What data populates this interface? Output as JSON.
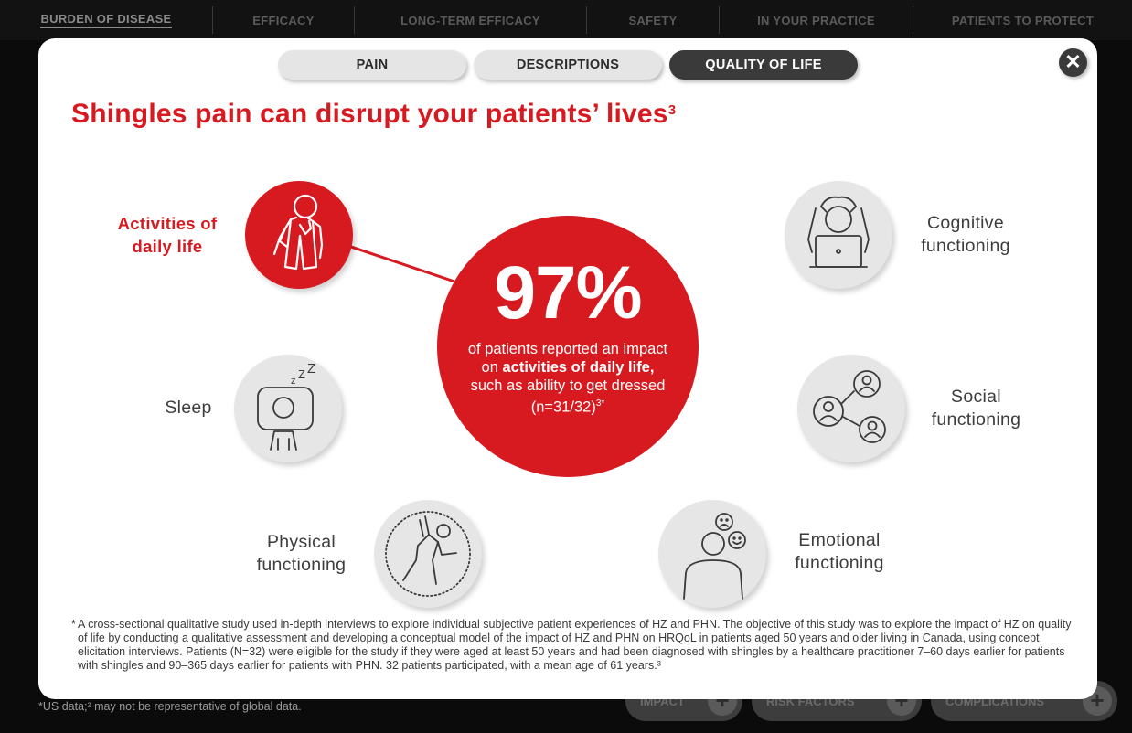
{
  "nav": {
    "items": [
      "BURDEN OF DISEASE",
      "EFFICACY",
      "LONG-TERM EFFICACY",
      "SAFETY",
      "IN YOUR PRACTICE",
      "PATIENTS TO PROTECT"
    ]
  },
  "background": {
    "footnote": "*US data;² may not be representative of global data.",
    "buttons": [
      "IMPACT",
      "RISK FACTORS",
      "COMPLICATIONS"
    ]
  },
  "modal": {
    "tabs": [
      "PAIN",
      "DESCRIPTIONS",
      "QUALITY OF LIFE"
    ],
    "active_tab": "QUALITY OF LIFE",
    "close_symbol": "✕",
    "headline": "Shingles pain can disrupt your patients’ lives",
    "headline_ref": "3",
    "stat": {
      "value": "97%",
      "line1": "of patients reported an impact on ",
      "bold": "activities of daily life,",
      "line2": " such as ability to get dressed (n=31/32)",
      "ref": "3*"
    },
    "domains": {
      "activities": {
        "line1": "Activities of",
        "line2": "daily life",
        "icon": "dressing-person-icon"
      },
      "sleep": {
        "label": "Sleep",
        "icon": "sleeping-person-icon"
      },
      "physical": {
        "line1": "Physical",
        "line2": "functioning",
        "icon": "exercising-person-icon"
      },
      "cognitive": {
        "line1": "Cognitive",
        "line2": "functioning",
        "icon": "person-laptop-icon"
      },
      "social": {
        "line1": "Social",
        "line2": "functioning",
        "icon": "social-network-icon"
      },
      "emotional": {
        "line1": "Emotional",
        "line2": "functioning",
        "icon": "emotional-faces-icon"
      }
    },
    "footnote": "A cross-sectional qualitative study used in-depth interviews to explore individual subjective patient experiences of HZ and PHN. The objective of this study was to explore the impact of HZ on quality of life by conducting a qualitative assessment and developing a conceptual model of the impact of HZ and PHN on HRQoL in patients aged 50 years and older living in Canada, using concept elicitation interviews. Patients (N=32) were eligible for the study if they were aged at least 50 years and had been diagnosed with shingles by a healthcare practitioner 7–60 days earlier for patients with shingles and 90–365 days earlier for patients with PHN. 32 patients participated, with a mean age of 61 years.³"
  },
  "colors": {
    "accent": "#d71920",
    "dark": "#3a3a3a",
    "icon_bg": "#e6e6e6"
  }
}
